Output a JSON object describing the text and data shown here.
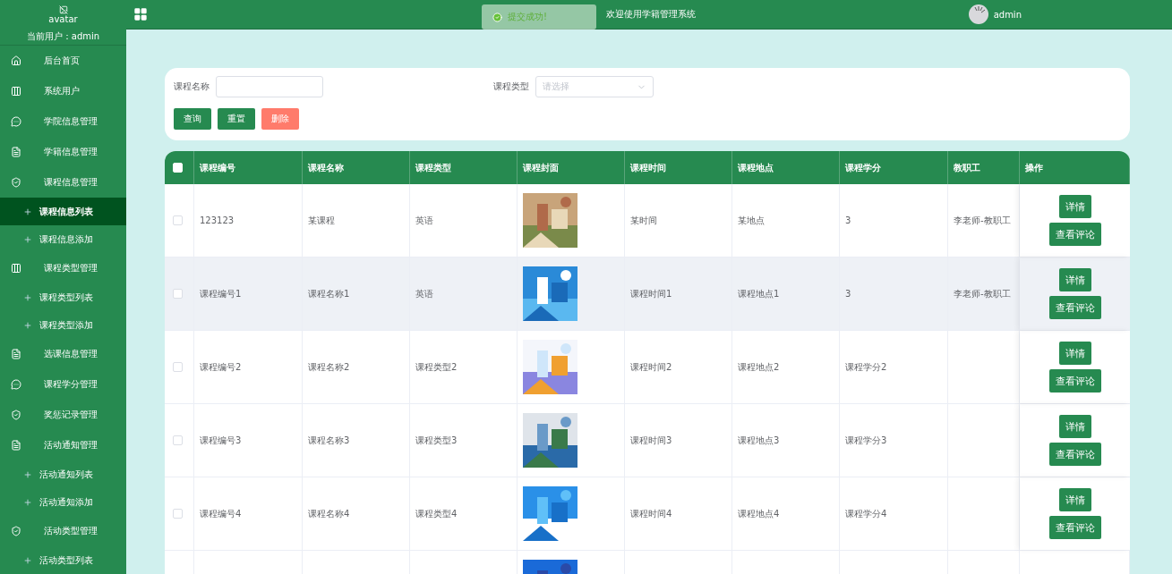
{
  "sidebar": {
    "avatar_alt": "avatar",
    "current_user": "当前用户：admin",
    "items": [
      {
        "label": "后台首页",
        "kind": "home",
        "selected": false
      },
      {
        "label": "系统用户",
        "kind": "columns",
        "selected": false
      },
      {
        "label": "学院信息管理",
        "kind": "chat",
        "selected": false
      },
      {
        "label": "学籍信息管理",
        "kind": "doc",
        "selected": false
      },
      {
        "label": "课程信息管理",
        "kind": "shield",
        "selected": false,
        "children": [
          {
            "label": "课程信息列表",
            "selected": true
          },
          {
            "label": "课程信息添加",
            "selected": false
          }
        ]
      },
      {
        "label": "课程类型管理",
        "kind": "columns",
        "selected": false,
        "children": [
          {
            "label": "课程类型列表",
            "selected": false
          },
          {
            "label": "课程类型添加",
            "selected": false
          }
        ]
      },
      {
        "label": "选课信息管理",
        "kind": "doc",
        "selected": false
      },
      {
        "label": "课程学分管理",
        "kind": "chat",
        "selected": false
      },
      {
        "label": "奖惩记录管理",
        "kind": "shield",
        "selected": false
      },
      {
        "label": "活动通知管理",
        "kind": "doc",
        "selected": false,
        "children": [
          {
            "label": "活动通知列表",
            "selected": false
          },
          {
            "label": "活动通知添加",
            "selected": false
          }
        ]
      },
      {
        "label": "活动类型管理",
        "kind": "shield",
        "selected": false,
        "children": [
          {
            "label": "活动类型列表",
            "selected": false
          }
        ]
      }
    ]
  },
  "header": {
    "title": "欢迎使用学籍管理系统",
    "user": "admin"
  },
  "toast": {
    "message": "提交成功!"
  },
  "search": {
    "fields": [
      {
        "label": "课程名称",
        "kind": "input"
      },
      {
        "label": "课程类型",
        "kind": "select",
        "placeholder": "请选择"
      }
    ],
    "buttons": [
      {
        "label": "查询",
        "kind": "primary"
      },
      {
        "label": "重置",
        "kind": "primary"
      },
      {
        "label": "删除",
        "kind": "danger"
      }
    ]
  },
  "table": {
    "select_all_checked": false,
    "columns": [
      "课程编号",
      "课程名称",
      "课程类型",
      "课程封面",
      "课程时间",
      "课程地点",
      "课程学分",
      "教职工",
      "操作"
    ],
    "rows": [
      {
        "checked": false,
        "highlighted": false,
        "cells": [
          "123123",
          "某课程",
          "英语",
          null,
          "某时间",
          "某地点",
          "3",
          "李老师-教职工"
        ],
        "actions": [
          "详情",
          "查看评论"
        ]
      },
      {
        "checked": false,
        "highlighted": true,
        "cells": [
          "课程编号1",
          "课程名称1",
          "英语",
          null,
          "课程时间1",
          "课程地点1",
          "3",
          "李老师-教职工"
        ],
        "actions": [
          "详情",
          "查看评论"
        ]
      },
      {
        "checked": false,
        "highlighted": false,
        "cells": [
          "课程编号2",
          "课程名称2",
          "课程类型2",
          null,
          "课程时间2",
          "课程地点2",
          "课程学分2",
          null
        ],
        "actions": [
          "详情",
          "查看评论"
        ]
      },
      {
        "checked": false,
        "highlighted": false,
        "cells": [
          "课程编号3",
          "课程名称3",
          "课程类型3",
          null,
          "课程时间3",
          "课程地点3",
          "课程学分3",
          null
        ],
        "actions": [
          "详情",
          "查看评论"
        ]
      },
      {
        "checked": false,
        "highlighted": false,
        "cells": [
          "课程编号4",
          "课程名称4",
          "课程类型4",
          null,
          "课程时间4",
          "课程地点4",
          "课程学分4",
          null
        ],
        "actions": [
          "详情",
          "查看评论"
        ]
      },
      {
        "cells": [
          null,
          null,
          null,
          null,
          null,
          null,
          null,
          null
        ]
      }
    ]
  }
}
